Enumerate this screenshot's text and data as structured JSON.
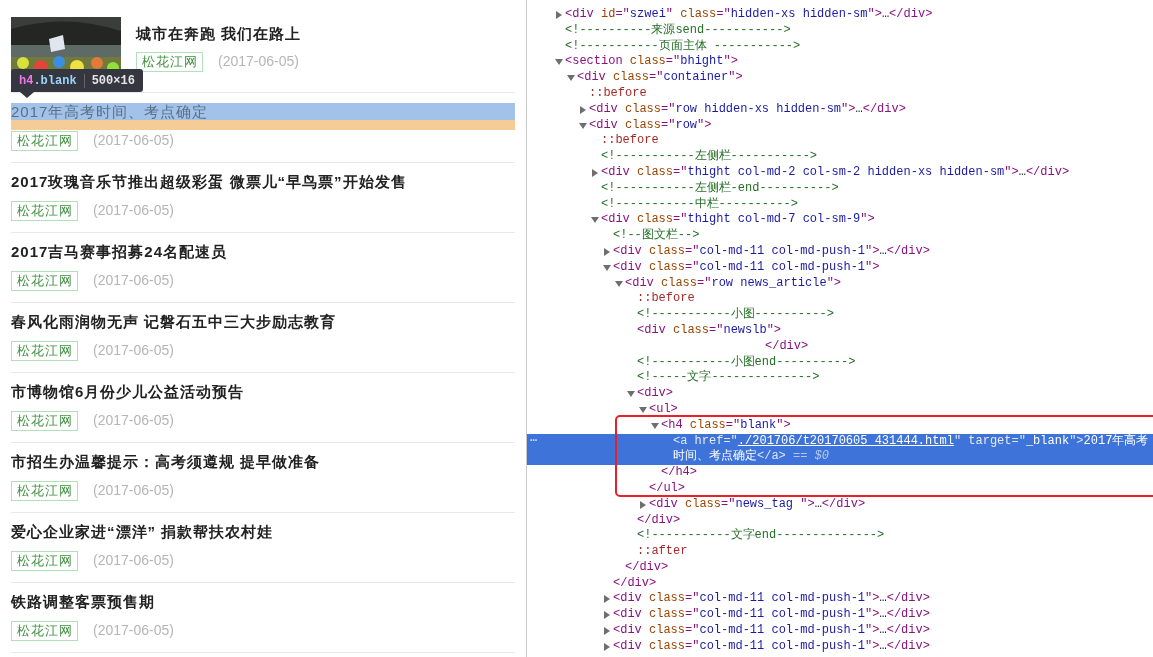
{
  "news": [
    {
      "kind": "picture",
      "title": "城市在奔跑 我们在路上",
      "source": "松花江网",
      "date": "(2017-06-05)",
      "inspected": false
    },
    {
      "kind": "text",
      "title": "2017年高考时间、考点确定",
      "source": "松花江网",
      "date": "(2017-06-05)",
      "inspected": true
    },
    {
      "kind": "text",
      "title": "2017玫瑰音乐节推出超级彩蛋 微票儿“早鸟票”开始发售",
      "source": "松花江网",
      "date": "(2017-06-05)",
      "inspected": false
    },
    {
      "kind": "text",
      "title": "2017吉马赛事招募24名配速员",
      "source": "松花江网",
      "date": "(2017-06-05)",
      "inspected": false
    },
    {
      "kind": "text",
      "title": "春风化雨润物无声 记磐石五中三大步励志教育",
      "source": "松花江网",
      "date": "(2017-06-05)",
      "inspected": false
    },
    {
      "kind": "text",
      "title": "市博物馆6月份少儿公益活动预告",
      "source": "松花江网",
      "date": "(2017-06-05)",
      "inspected": false
    },
    {
      "kind": "text",
      "title": "市招生办温馨提示：高考须遵规 提早做准备",
      "source": "松花江网",
      "date": "(2017-06-05)",
      "inspected": false
    },
    {
      "kind": "text",
      "title": "爱心企业家进“漂洋” 捐款帮扶农村娃",
      "source": "松花江网",
      "date": "(2017-06-05)",
      "inspected": false
    },
    {
      "kind": "text",
      "title": "铁路调整客票预售期",
      "source": "松花江网",
      "date": "(2017-06-05)",
      "inspected": false
    }
  ],
  "inspector_tooltip": {
    "tag": "h4",
    "class": ".blank",
    "size": "500×16"
  },
  "devtools": {
    "gutter_mark": "⋯",
    "console_ref": "== $0",
    "tree": [
      {
        "kind": "element",
        "line": "<div id=\"szwei\" class=\"hidden-xs hidden-sm\">…</div>",
        "expanded": false,
        "selected": false
      },
      {
        "kind": "comment",
        "line": "<!----------来源send----------->",
        "selected": false
      },
      {
        "kind": "comment",
        "line": "<!-----------页面主体 ----------->",
        "selected": false
      },
      {
        "kind": "element",
        "line": "<section class=\"bhight\">",
        "expanded": true,
        "selected": false,
        "children": [
          {
            "kind": "element",
            "line": "<div class=\"container\">",
            "expanded": true,
            "selected": false,
            "children": [
              {
                "kind": "pseudo",
                "line": "::before",
                "selected": false
              },
              {
                "kind": "element",
                "line": "<div class=\"row hidden-xs hidden-sm\">…</div>",
                "expanded": false,
                "selected": false
              },
              {
                "kind": "element",
                "line": "<div class=\"row\">",
                "expanded": true,
                "selected": false,
                "children": [
                  {
                    "kind": "pseudo",
                    "line": "::before",
                    "selected": false
                  },
                  {
                    "kind": "comment",
                    "line": "<!-----------左侧栏----------->",
                    "selected": false
                  },
                  {
                    "kind": "element",
                    "line": "<div class=\"thight col-md-2 col-sm-2 hidden-xs hidden-sm\">…</div>",
                    "expanded": false,
                    "selected": false
                  },
                  {
                    "kind": "comment",
                    "line": "<!-----------左侧栏-end---------->",
                    "selected": false
                  },
                  {
                    "kind": "comment",
                    "line": "<!-----------中栏---------->",
                    "selected": false
                  },
                  {
                    "kind": "element",
                    "line": "<div class=\"thight col-md-7 col-sm-9\">",
                    "expanded": true,
                    "selected": false,
                    "children": [
                      {
                        "kind": "comment",
                        "line": "<!--图文栏-->",
                        "selected": false
                      },
                      {
                        "kind": "element",
                        "line": "<div class=\"col-md-11 col-md-push-1\">…</div>",
                        "expanded": false,
                        "selected": false
                      },
                      {
                        "kind": "element",
                        "line": "<div class=\"col-md-11 col-md-push-1\">",
                        "expanded": true,
                        "end": "</div>",
                        "selected": false,
                        "children": [
                          {
                            "kind": "element",
                            "line": "<div class=\"row news_article\">",
                            "expanded": true,
                            "end": "</div>",
                            "selected": false,
                            "children": [
                              {
                                "kind": "pseudo",
                                "line": "::before",
                                "selected": false
                              },
                              {
                                "kind": "comment",
                                "line": "<!-----------小图---------->",
                                "selected": false
                              },
                              {
                                "kind": "element",
                                "line": "<div class=\"newslb\">",
                                "end": "</div>",
                                "selected": false
                              },
                              {
                                "kind": "comment",
                                "line": "<!-----------小图end---------->",
                                "selected": false
                              },
                              {
                                "kind": "comment",
                                "line": "<!-----文字-------------->",
                                "selected": false
                              },
                              {
                                "kind": "element",
                                "line": "<div>",
                                "expanded": true,
                                "end": "</div>",
                                "selected": false,
                                "children": [
                                  {
                                    "kind": "element",
                                    "line": "<ul>",
                                    "expanded": true,
                                    "end": "</ul>",
                                    "selected": false,
                                    "children": [
                                      {
                                        "kind": "element",
                                        "line": "<h4 class=\"blank\">",
                                        "expanded": true,
                                        "end": "</h4>",
                                        "selected": false,
                                        "children": [
                                          {
                                            "kind": "element",
                                            "line": "<a href=\"./201706/t20170605_431444.html\" target=\"_blank\">2017年高考时间、考点确定</a>",
                                            "selected": true
                                          }
                                        ]
                                      }
                                    ]
                                  },
                                  {
                                    "kind": "element",
                                    "line": "<div class=\"news_tag \">…</div>",
                                    "expanded": false,
                                    "selected": false
                                  }
                                ]
                              },
                              {
                                "kind": "comment",
                                "line": "<!-----------文字end-------------->",
                                "selected": false
                              },
                              {
                                "kind": "pseudo",
                                "line": "::after",
                                "selected": false
                              }
                            ]
                          }
                        ]
                      },
                      {
                        "kind": "element",
                        "line": "<div class=\"col-md-11 col-md-push-1\">…</div>",
                        "expanded": false,
                        "selected": false
                      },
                      {
                        "kind": "element",
                        "line": "<div class=\"col-md-11 col-md-push-1\">…</div>",
                        "expanded": false,
                        "selected": false
                      },
                      {
                        "kind": "element",
                        "line": "<div class=\"col-md-11 col-md-push-1\">…</div>",
                        "expanded": false,
                        "selected": false
                      },
                      {
                        "kind": "element",
                        "line": "<div class=\"col-md-11 col-md-push-1\">…</div>",
                        "expanded": false,
                        "selected": false
                      }
                    ]
                  }
                ]
              }
            ]
          }
        ]
      }
    ]
  }
}
